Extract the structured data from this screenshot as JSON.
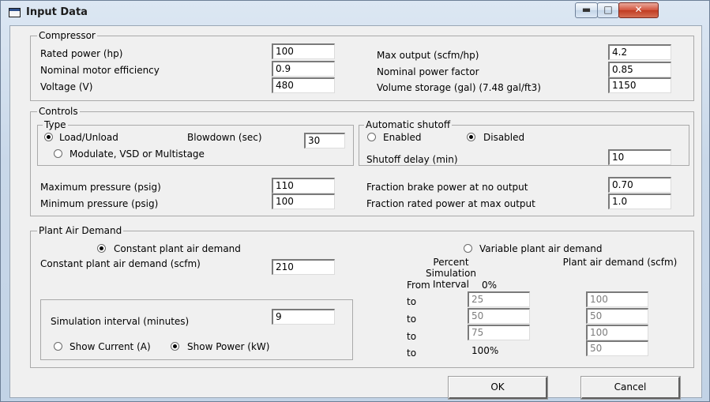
{
  "window": {
    "title": "Input Data"
  },
  "compressor": {
    "group_label": "Compressor",
    "rated_power_label": "Rated power (hp)",
    "rated_power": "100",
    "motor_eff_label": "Nominal motor efficiency",
    "motor_eff": "0.9",
    "voltage_label": "Voltage (V)",
    "voltage": "480",
    "max_output_label": "Max output (scfm/hp)",
    "max_output": "4.2",
    "power_factor_label": "Nominal power factor",
    "power_factor": "0.85",
    "volume_label": "Volume storage (gal) (7.48 gal/ft3)",
    "volume": "1150"
  },
  "controls": {
    "group_label": "Controls",
    "type_label": "Type",
    "load_unload_label": "Load/Unload",
    "load_unload_selected": true,
    "blowdown_label": "Blowdown (sec)",
    "blowdown": "30",
    "modulate_label": "Modulate, VSD or Multistage",
    "auto_shutoff_label": "Automatic shutoff",
    "enabled_label": "Enabled",
    "disabled_label": "Disabled",
    "disabled_selected": true,
    "shutoff_delay_label": "Shutoff delay (min)",
    "shutoff_delay": "10",
    "max_pressure_label": "Maximum pressure (psig)",
    "max_pressure": "110",
    "min_pressure_label": "Minimum pressure (psig)",
    "min_pressure": "100",
    "brake_power_label": "Fraction brake power at no output",
    "brake_power": "0.70",
    "rated_power_max_label": "Fraction rated power at max output",
    "rated_power_max": "1.0"
  },
  "plant": {
    "group_label": "Plant Air Demand",
    "constant_radio_label": "Constant plant air demand",
    "constant_selected": true,
    "variable_radio_label": "Variable plant air demand",
    "constant_demand_label": "Constant plant air demand (scfm)",
    "constant_demand": "210",
    "percent_header": "Percent Simulation Interval",
    "demand_header": "Plant air demand (scfm)",
    "from_label": "From",
    "from_value": "0%",
    "rows": [
      {
        "label": "to",
        "percent": "25",
        "demand": "100"
      },
      {
        "label": "to",
        "percent": "50",
        "demand": "50"
      },
      {
        "label": "to",
        "percent": "75",
        "demand": "100"
      },
      {
        "label": "to",
        "percent": "100%",
        "demand": "50"
      }
    ],
    "sim_interval_label": "Simulation interval (minutes)",
    "sim_interval": "9",
    "show_current_label": "Show Current (A)",
    "show_power_label": "Show Power (kW)",
    "show_power_selected": true
  },
  "buttons": {
    "ok": "OK",
    "cancel": "Cancel"
  }
}
